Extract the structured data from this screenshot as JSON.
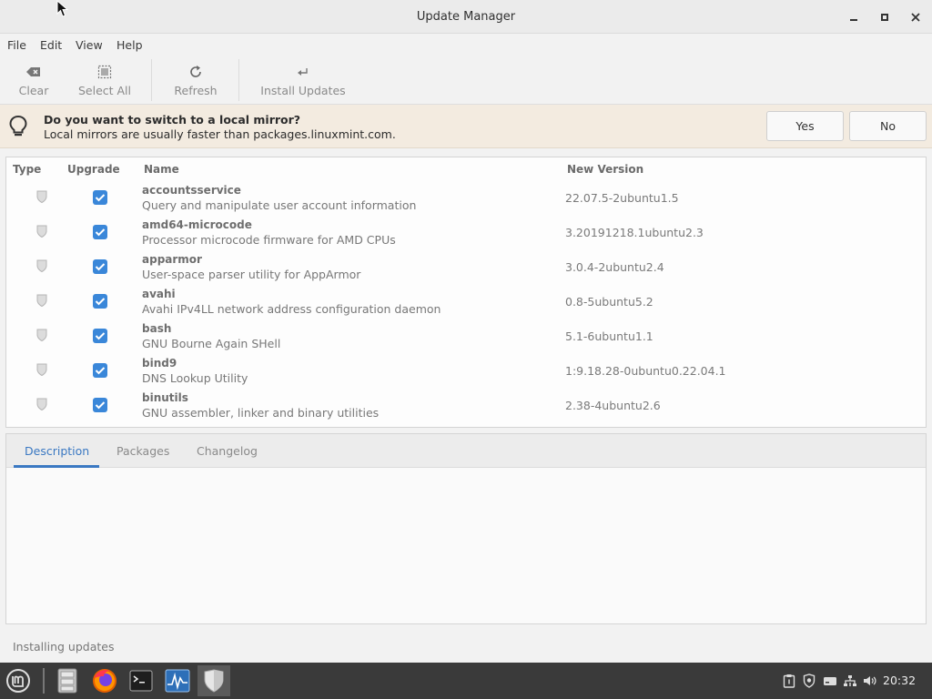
{
  "window": {
    "title": "Update Manager"
  },
  "menu": {
    "file": "File",
    "edit": "Edit",
    "view": "View",
    "help": "Help"
  },
  "toolbar": {
    "clear": "Clear",
    "select_all": "Select All",
    "refresh": "Refresh",
    "install": "Install Updates"
  },
  "infobar": {
    "title": "Do you want to switch to a local mirror?",
    "message": "Local mirrors are usually faster than packages.linuxmint.com.",
    "yes": "Yes",
    "no": "No"
  },
  "columns": {
    "type": "Type",
    "upgrade": "Upgrade",
    "name": "Name",
    "version": "New Version"
  },
  "packages": [
    {
      "name": "accountsservice",
      "desc": "Query and manipulate user account information",
      "version": "22.07.5-2ubuntu1.5"
    },
    {
      "name": "amd64-microcode",
      "desc": "Processor microcode firmware for AMD CPUs",
      "version": "3.20191218.1ubuntu2.3"
    },
    {
      "name": "apparmor",
      "desc": "User-space parser utility for AppArmor",
      "version": "3.0.4-2ubuntu2.4"
    },
    {
      "name": "avahi",
      "desc": "Avahi IPv4LL network address configuration daemon",
      "version": "0.8-5ubuntu5.2"
    },
    {
      "name": "bash",
      "desc": "GNU Bourne Again SHell",
      "version": "5.1-6ubuntu1.1"
    },
    {
      "name": "bind9",
      "desc": "DNS Lookup Utility",
      "version": "1:9.18.28-0ubuntu0.22.04.1"
    },
    {
      "name": "binutils",
      "desc": "GNU assembler, linker and binary utilities",
      "version": "2.38-4ubuntu2.6"
    }
  ],
  "tabs": {
    "description": "Description",
    "packages": "Packages",
    "changelog": "Changelog"
  },
  "status": "Installing updates",
  "taskbar": {
    "clock": "20:32"
  },
  "colors": {
    "accent": "#3a78c2",
    "checkbox": "#3a87d9",
    "infobar_bg": "#f3ebe0",
    "taskbar_bg": "#3a3a3a"
  }
}
